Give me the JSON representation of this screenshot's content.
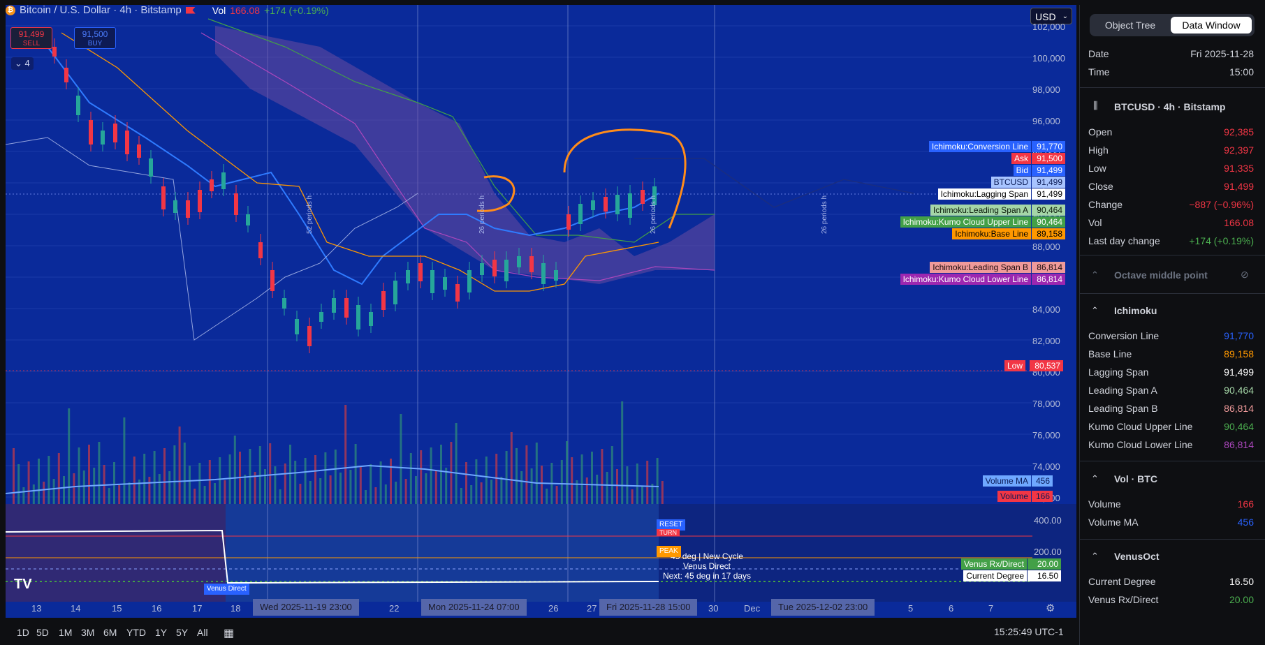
{
  "header": {
    "symbol_title": "Bitcoin / U.S. Dollar · 4h · Bitstamp",
    "vol_label": "Vol",
    "vol_value": "166.08",
    "vol_change": "+174 (+0.19%)",
    "sell_price": "91,499",
    "sell_label": "SELL",
    "buy_price": "91,500",
    "buy_label": "BUY",
    "indicator_count": "4",
    "currency": "USD"
  },
  "price_axis": {
    "ticks": [
      "102,000",
      "100,000",
      "98,000",
      "96,000",
      "94,000",
      "92,000",
      "90,000",
      "88,000",
      "86,000",
      "84,000",
      "82,000",
      "80,000",
      "78,000",
      "76,000",
      "74,000",
      "72,000"
    ],
    "osc_ticks": [
      "400.00",
      "200.00"
    ]
  },
  "price_tags": [
    {
      "label": "Ichimoku:Conversion Line",
      "value": "91,770",
      "bg": "#2962ff",
      "fg": "#ffffff"
    },
    {
      "label": "Ask",
      "value": "91,500",
      "bg": "#f23645",
      "fg": "#ffffff"
    },
    {
      "label": "Bid",
      "value": "91,499",
      "bg": "#2962ff",
      "fg": "#ffffff"
    },
    {
      "label": "BTCUSD",
      "value": "91,499",
      "bg": "#a8c4ff",
      "fg": "#0a1a55"
    },
    {
      "label": "Ichimoku:Lagging Span",
      "value": "91,499",
      "bg": "#ffffff",
      "fg": "#000000"
    },
    {
      "label": "Ichimoku:Leading Span A",
      "value": "90,464",
      "bg": "#a5d6a7",
      "fg": "#0a1a0a"
    },
    {
      "label": "Ichimoku:Kumo Cloud Upper Line",
      "value": "90,464",
      "bg": "#43a047",
      "fg": "#ffffff"
    },
    {
      "label": "Ichimoku:Base Line",
      "value": "89,158",
      "bg": "#ff9800",
      "fg": "#000000"
    },
    {
      "label": "Ichimoku:Leading Span B",
      "value": "86,814",
      "bg": "#ef9a9a",
      "fg": "#1a0a0a"
    },
    {
      "label": "Ichimoku:Kumo Cloud Lower Line",
      "value": "86,814",
      "bg": "#9c27b0",
      "fg": "#ffffff"
    }
  ],
  "low_tag": {
    "label": "Low",
    "value": "80,537"
  },
  "volume_tags": [
    {
      "label": "Volume MA",
      "value": "456",
      "bg": "#6fa8ff"
    },
    {
      "label": "Volume",
      "value": "166",
      "bg": "#f23645"
    }
  ],
  "osc_tags": [
    {
      "label": "Venus Rx/Direct",
      "value": "20.00",
      "bg": "#43a047",
      "fg": "#ffffff"
    },
    {
      "label": "Current Degree",
      "value": "16.50",
      "bg": "#ffffff",
      "fg": "#000000"
    }
  ],
  "osc": {
    "reset_label": "RESET",
    "turn_label": "TURN",
    "peak_label": "PEAK",
    "venus_direct_label": "Venus Direct",
    "note_line1": "45 deg | New Cycle",
    "note_line2": "Venus Direct",
    "note_line3": "Next: 45 deg in 17 days"
  },
  "period_labels": [
    "52 periods h",
    "26 periods h",
    "26 periods h",
    "26 periods h"
  ],
  "time_axis": {
    "labels": [
      "13",
      "14",
      "15",
      "16",
      "17",
      "18",
      "22",
      "26",
      "27",
      "30",
      "Dec",
      "5",
      "6",
      "7"
    ],
    "highlights": [
      "Wed 2025-11-19   23:00",
      "Mon 2025-11-24   07:00",
      "Fri 2025-11-28   15:00",
      "Tue 2025-12-02   23:00"
    ]
  },
  "timeframes": [
    "1D",
    "5D",
    "1M",
    "3M",
    "6M",
    "YTD",
    "1Y",
    "5Y",
    "All"
  ],
  "clock": "15:25:49 UTC-1",
  "panel": {
    "tab_object_tree": "Object Tree",
    "tab_data_window": "Data Window",
    "date_label": "Date",
    "date_value": "Fri 2025-11-28",
    "time_label": "Time",
    "time_value": "15:00",
    "symbol_section": "BTCUSD · 4h · Bitstamp",
    "ohlc": [
      {
        "label": "Open",
        "value": "92,385",
        "color": "#f23645"
      },
      {
        "label": "High",
        "value": "92,397",
        "color": "#f23645"
      },
      {
        "label": "Low",
        "value": "91,335",
        "color": "#f23645"
      },
      {
        "label": "Close",
        "value": "91,499",
        "color": "#f23645"
      },
      {
        "label": "Change",
        "value": "−887 (−0.96%)",
        "color": "#f23645"
      },
      {
        "label": "Vol",
        "value": "166.08",
        "color": "#f23645"
      },
      {
        "label": "Last day change",
        "value": "+174 (+0.19%)",
        "color": "#4caf50"
      }
    ],
    "octave_section": "Octave middle point",
    "ichimoku_section": "Ichimoku",
    "ichimoku": [
      {
        "label": "Conversion Line",
        "value": "91,770",
        "color": "#2962ff"
      },
      {
        "label": "Base Line",
        "value": "89,158",
        "color": "#ff9800"
      },
      {
        "label": "Lagging Span",
        "value": "91,499",
        "color": "#ffffff"
      },
      {
        "label": "Leading Span A",
        "value": "90,464",
        "color": "#a5d6a7"
      },
      {
        "label": "Leading Span B",
        "value": "86,814",
        "color": "#ef9a9a"
      },
      {
        "label": "Kumo Cloud Upper Line",
        "value": "90,464",
        "color": "#4caf50"
      },
      {
        "label": "Kumo Cloud Lower Line",
        "value": "86,814",
        "color": "#ab47bc"
      }
    ],
    "vol_section": "Vol · BTC",
    "vol": [
      {
        "label": "Volume",
        "value": "166",
        "color": "#f23645"
      },
      {
        "label": "Volume MA",
        "value": "456",
        "color": "#2962ff"
      }
    ],
    "venus_section": "VenusOct",
    "venus": [
      {
        "label": "Current Degree",
        "value": "16.50",
        "color": "#ffffff"
      },
      {
        "label": "Venus Rx/Direct",
        "value": "20.00",
        "color": "#4caf50"
      }
    ]
  }
}
